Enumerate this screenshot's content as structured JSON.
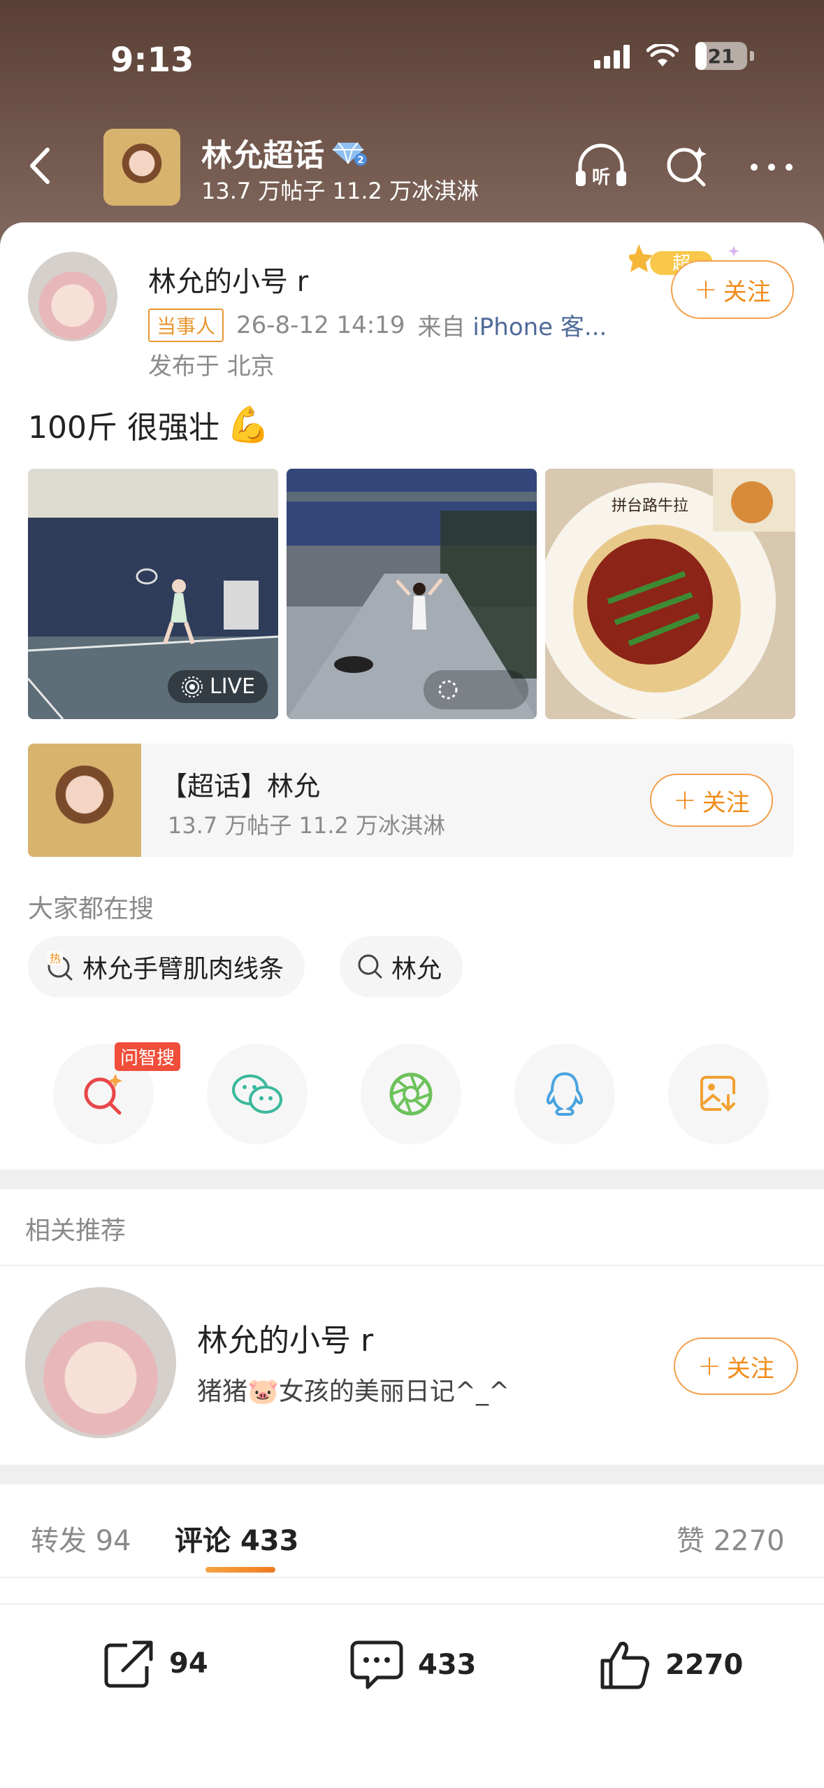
{
  "status_bar": {
    "time": "9:13",
    "battery": "21"
  },
  "header": {
    "topic_title": "林允超话",
    "topic_stats": "13.7 万帖子 11.2 万冰淇淋",
    "listen_label": "听"
  },
  "post": {
    "author": "林允的小号 r",
    "role_badge": "当事人",
    "timestamp": "26-8-12 14:19",
    "from_prefix": "来自",
    "from_device": "iPhone 客...",
    "location": "发布于 北京",
    "follow_label": "关注",
    "super_tag": "超",
    "text": "100斤 很强壮",
    "emoji": "💪",
    "photos": [
      {
        "name": "tennis-court-photo",
        "badge": "LIVE"
      },
      {
        "name": "street-photo"
      },
      {
        "name": "noodles-photo",
        "sign": "拼台路牛拉"
      }
    ]
  },
  "supertopic": {
    "title": "【超话】林允",
    "stats": "13.7 万帖子 11.2 万冰淇淋",
    "follow_label": "关注"
  },
  "search": {
    "label": "大家都在搜",
    "hot_tag": "热",
    "chips": [
      "林允手臂肌肉线条",
      "林允"
    ]
  },
  "share": {
    "wenzhi_tag": "问智搜",
    "icons": [
      "wenzhi-search-icon",
      "wechat-icon",
      "moments-icon",
      "qq-icon",
      "save-image-icon"
    ]
  },
  "recommend": {
    "label": "相关推荐",
    "name": "林允的小号 r",
    "bio_prefix": "猪猪",
    "bio_emoji": "🐷",
    "bio_suffix": "女孩的美丽日记^_^",
    "follow_label": "关注"
  },
  "tabs": {
    "repost_label": "转发",
    "repost_count": "94",
    "comment_label": "评论",
    "comment_count": "433",
    "like_label": "赞",
    "like_count": "2270"
  },
  "bottom_bar": {
    "repost_count": "94",
    "comment_count": "433",
    "like_count": "2270"
  },
  "colors": {
    "accent": "#f08c1b",
    "link": "#4f6a98",
    "badge_red": "#f04e3a"
  }
}
